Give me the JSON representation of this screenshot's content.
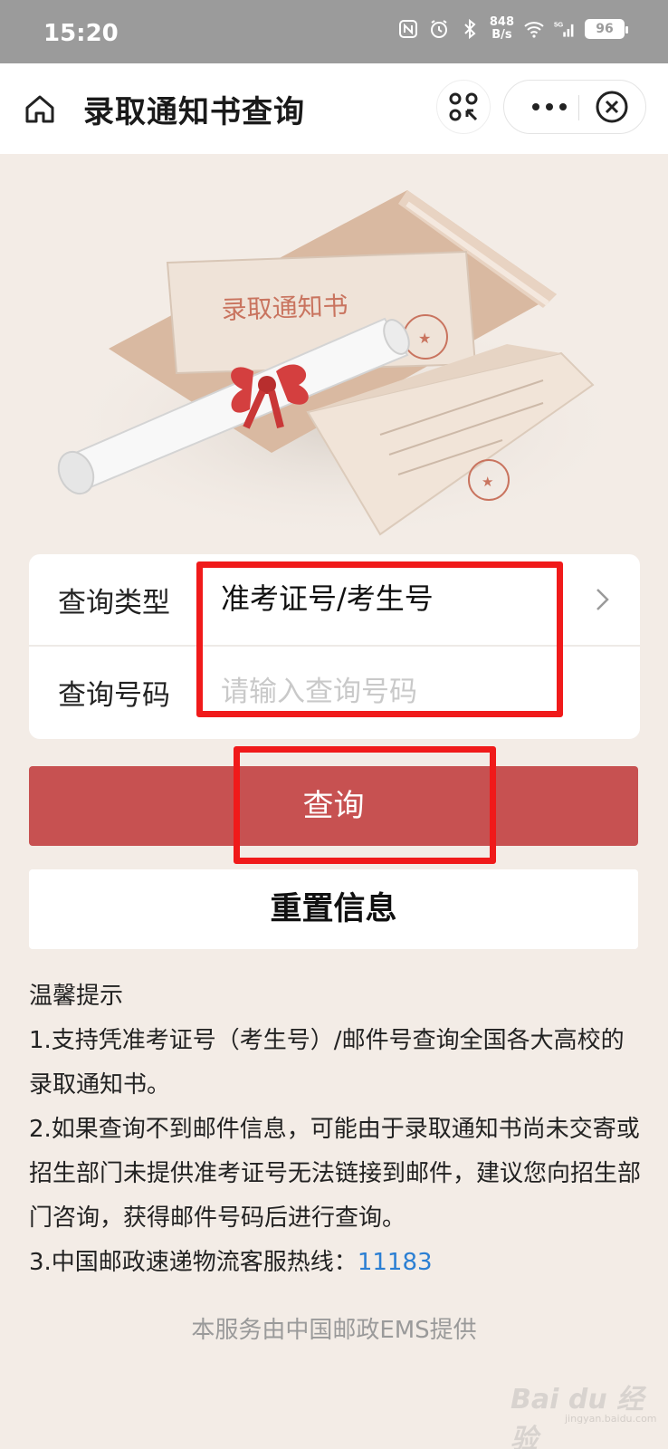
{
  "status_bar": {
    "time": "15:20",
    "net_speed_value": "848",
    "net_speed_unit": "B/s",
    "network": "5G",
    "battery": "96"
  },
  "nav": {
    "title": "录取通知书查询",
    "home_icon": "home-icon",
    "scan_icon": "scan-icon",
    "more_icon": "more-icon",
    "close_icon": "close-icon"
  },
  "hero_image": {
    "envelope_text": "录取通知书",
    "description": "admission letter envelope with scroll and red ribbon"
  },
  "form": {
    "type_label": "查询类型",
    "type_value": "准考证号/考生号",
    "number_label": "查询号码",
    "number_placeholder": "请输入查询号码",
    "number_value": ""
  },
  "buttons": {
    "query": "查询",
    "reset": "重置信息"
  },
  "tips": {
    "title": "温馨提示",
    "item1": "1.支持凭准考证号（考生号）/邮件号查询全国各大高校的录取通知书。",
    "item2": "2.如果查询不到邮件信息，可能由于录取通知书尚未交寄或招生部门未提供准考证号无法链接到邮件，建议您向招生部门咨询，获得邮件号码后进行查询。",
    "item3_prefix": "3.中国邮政速递物流客服热线：",
    "hotline": "11183"
  },
  "footer": "本服务由中国邮政EMS提供",
  "watermark": {
    "brand": "Bai du 经验",
    "site": "jingyan.baidu.com"
  },
  "colors": {
    "accent": "#c75151",
    "highlight": "#f01a1a",
    "link": "#2b7fd3",
    "background": "#f3ece6"
  }
}
